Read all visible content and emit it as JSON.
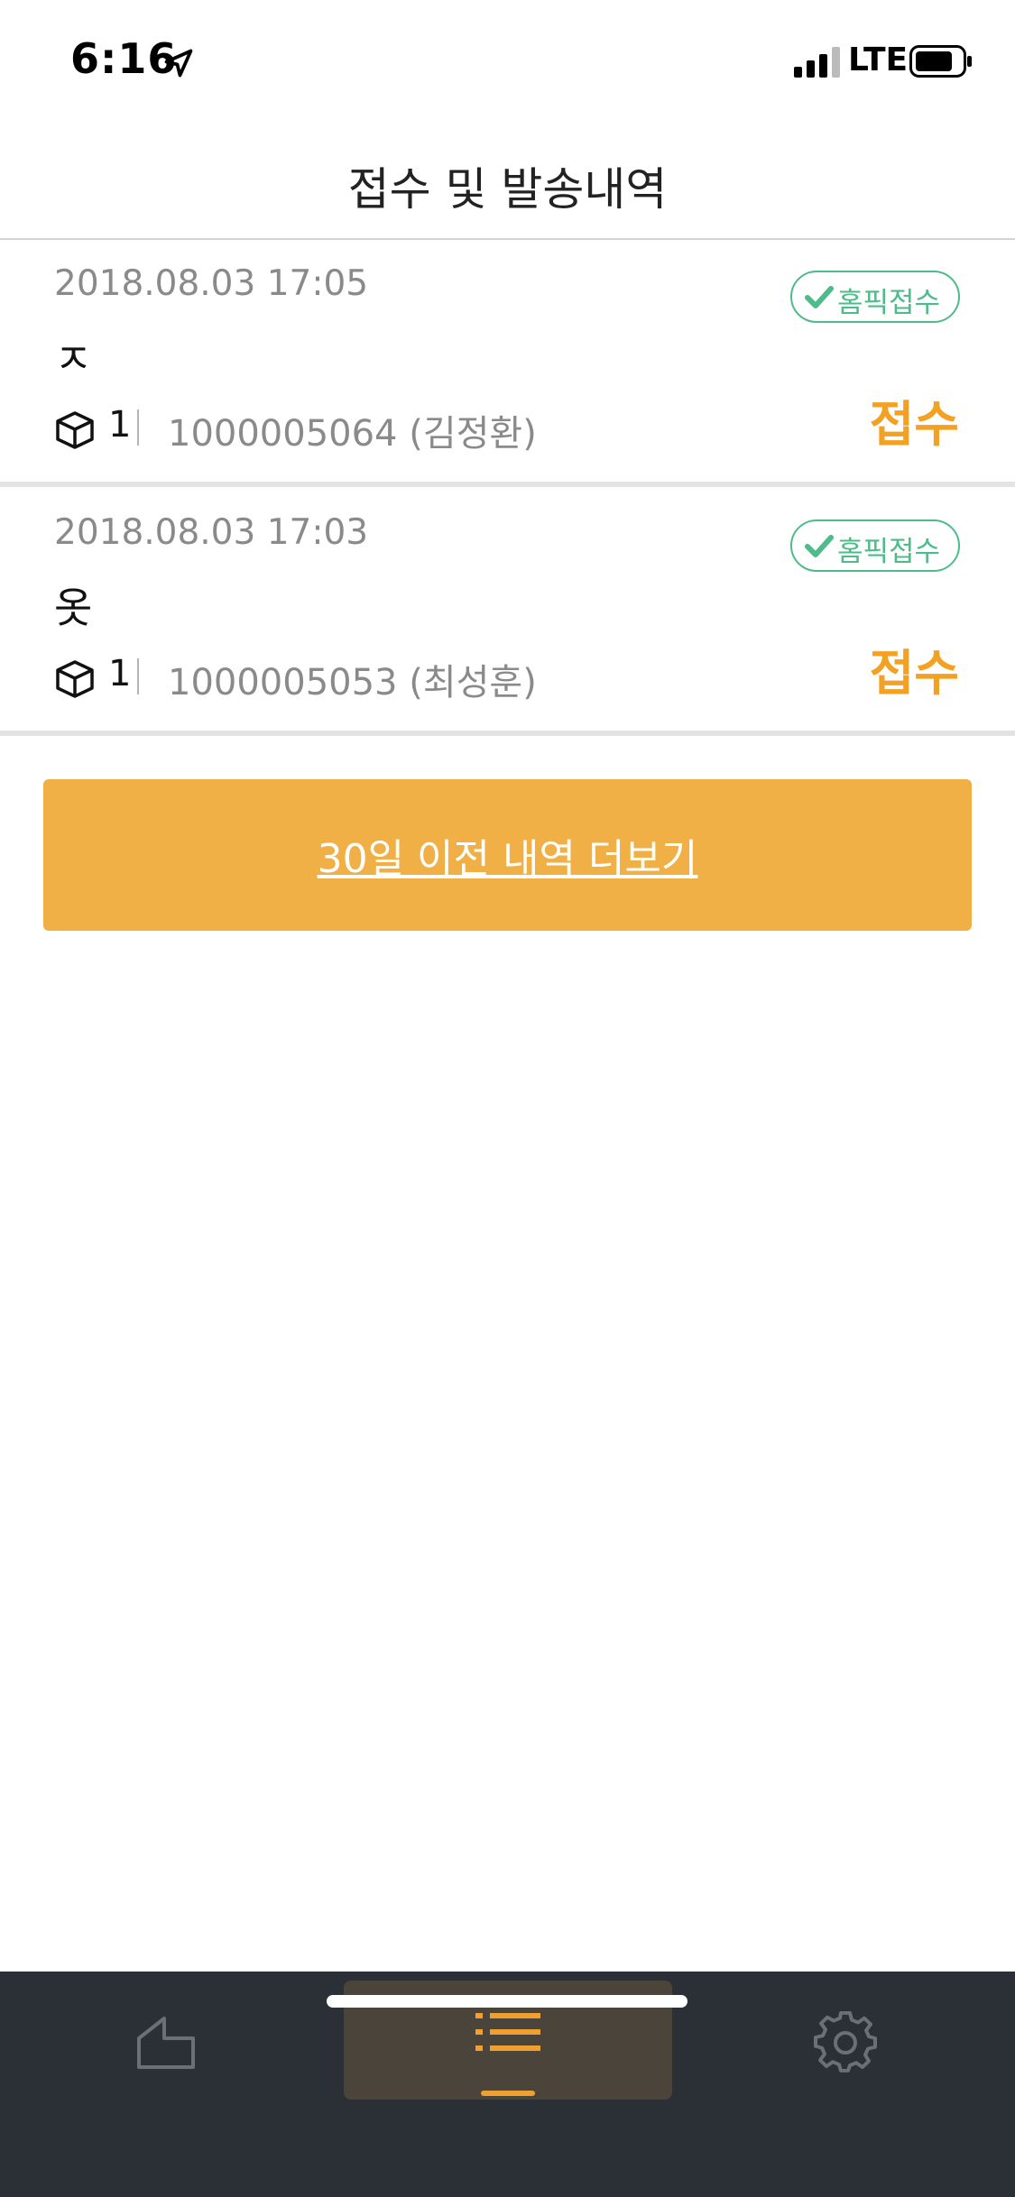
{
  "status_bar": {
    "time": "6:16",
    "network": "LTE"
  },
  "header": {
    "title": "접수 및 발송내역"
  },
  "items": [
    {
      "date": "2018.08.03 17:05",
      "badge": "홈픽접수",
      "name": "ㅈ",
      "count": "1",
      "tracking": "1000005064 (김정환)",
      "status": "접수"
    },
    {
      "date": "2018.08.03 17:03",
      "badge": "홈픽접수",
      "name": "옷",
      "count": "1",
      "tracking": "1000005053 (최성훈)",
      "status": "접수"
    }
  ],
  "load_more": {
    "label": "30일 이전 내역 더보기"
  },
  "tab_bar": {
    "tabs": [
      {
        "icon": "home-icon",
        "active": false
      },
      {
        "icon": "list-icon",
        "active": true
      },
      {
        "icon": "gear-icon",
        "active": false
      }
    ]
  },
  "colors": {
    "accent": "#f3a122",
    "button": "#f0b046",
    "badge": "#4dbb8a",
    "tab_bar": "#2b2f36"
  }
}
